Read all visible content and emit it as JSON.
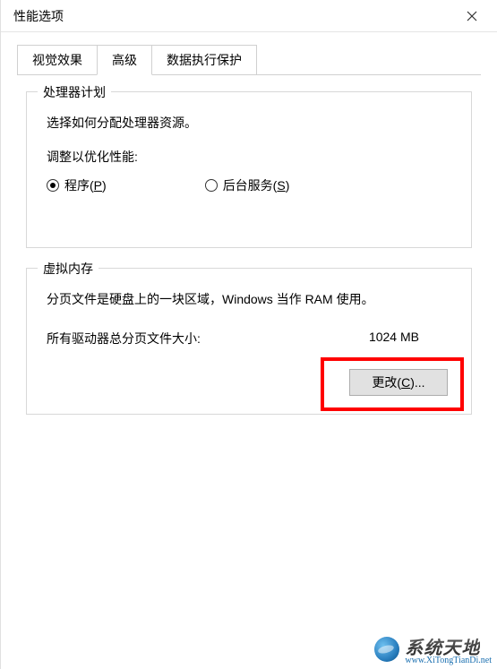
{
  "window": {
    "title": "性能选项"
  },
  "tabs": [
    {
      "label": "视觉效果",
      "active": false
    },
    {
      "label": "高级",
      "active": true
    },
    {
      "label": "数据执行保护",
      "active": false
    }
  ],
  "processor": {
    "legend": "处理器计划",
    "desc": "选择如何分配处理器资源。",
    "adjust_label": "调整以优化性能:",
    "radios": {
      "programs": {
        "label_prefix": "程序(",
        "hotkey": "P",
        "label_suffix": ")",
        "selected": true
      },
      "services": {
        "label_prefix": "后台服务(",
        "hotkey": "S",
        "label_suffix": ")",
        "selected": false
      }
    }
  },
  "virtual_memory": {
    "legend": "虚拟内存",
    "desc": "分页文件是硬盘上的一块区域，Windows 当作 RAM 使用。",
    "total_label": "所有驱动器总分页文件大小:",
    "total_value": "1024 MB",
    "change_label_prefix": "更改(",
    "change_hotkey": "C",
    "change_label_suffix": ")..."
  },
  "watermark": {
    "cn": "系统天地",
    "en": "www.XiTongTianDi.net"
  }
}
